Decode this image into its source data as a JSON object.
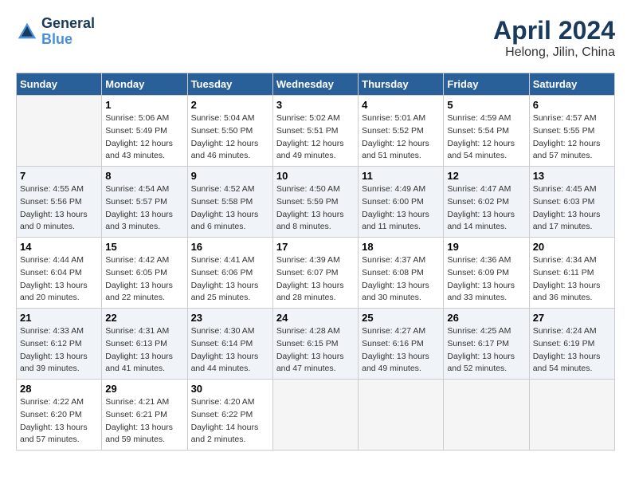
{
  "header": {
    "logo_line1": "General",
    "logo_line2": "Blue",
    "month_title": "April 2024",
    "location": "Helong, Jilin, China"
  },
  "weekdays": [
    "Sunday",
    "Monday",
    "Tuesday",
    "Wednesday",
    "Thursday",
    "Friday",
    "Saturday"
  ],
  "weeks": [
    [
      {
        "day": "",
        "empty": true
      },
      {
        "day": "1",
        "sunrise": "Sunrise: 5:06 AM",
        "sunset": "Sunset: 5:49 PM",
        "daylight": "Daylight: 12 hours and 43 minutes."
      },
      {
        "day": "2",
        "sunrise": "Sunrise: 5:04 AM",
        "sunset": "Sunset: 5:50 PM",
        "daylight": "Daylight: 12 hours and 46 minutes."
      },
      {
        "day": "3",
        "sunrise": "Sunrise: 5:02 AM",
        "sunset": "Sunset: 5:51 PM",
        "daylight": "Daylight: 12 hours and 49 minutes."
      },
      {
        "day": "4",
        "sunrise": "Sunrise: 5:01 AM",
        "sunset": "Sunset: 5:52 PM",
        "daylight": "Daylight: 12 hours and 51 minutes."
      },
      {
        "day": "5",
        "sunrise": "Sunrise: 4:59 AM",
        "sunset": "Sunset: 5:54 PM",
        "daylight": "Daylight: 12 hours and 54 minutes."
      },
      {
        "day": "6",
        "sunrise": "Sunrise: 4:57 AM",
        "sunset": "Sunset: 5:55 PM",
        "daylight": "Daylight: 12 hours and 57 minutes."
      }
    ],
    [
      {
        "day": "7",
        "sunrise": "Sunrise: 4:55 AM",
        "sunset": "Sunset: 5:56 PM",
        "daylight": "Daylight: 13 hours and 0 minutes."
      },
      {
        "day": "8",
        "sunrise": "Sunrise: 4:54 AM",
        "sunset": "Sunset: 5:57 PM",
        "daylight": "Daylight: 13 hours and 3 minutes."
      },
      {
        "day": "9",
        "sunrise": "Sunrise: 4:52 AM",
        "sunset": "Sunset: 5:58 PM",
        "daylight": "Daylight: 13 hours and 6 minutes."
      },
      {
        "day": "10",
        "sunrise": "Sunrise: 4:50 AM",
        "sunset": "Sunset: 5:59 PM",
        "daylight": "Daylight: 13 hours and 8 minutes."
      },
      {
        "day": "11",
        "sunrise": "Sunrise: 4:49 AM",
        "sunset": "Sunset: 6:00 PM",
        "daylight": "Daylight: 13 hours and 11 minutes."
      },
      {
        "day": "12",
        "sunrise": "Sunrise: 4:47 AM",
        "sunset": "Sunset: 6:02 PM",
        "daylight": "Daylight: 13 hours and 14 minutes."
      },
      {
        "day": "13",
        "sunrise": "Sunrise: 4:45 AM",
        "sunset": "Sunset: 6:03 PM",
        "daylight": "Daylight: 13 hours and 17 minutes."
      }
    ],
    [
      {
        "day": "14",
        "sunrise": "Sunrise: 4:44 AM",
        "sunset": "Sunset: 6:04 PM",
        "daylight": "Daylight: 13 hours and 20 minutes."
      },
      {
        "day": "15",
        "sunrise": "Sunrise: 4:42 AM",
        "sunset": "Sunset: 6:05 PM",
        "daylight": "Daylight: 13 hours and 22 minutes."
      },
      {
        "day": "16",
        "sunrise": "Sunrise: 4:41 AM",
        "sunset": "Sunset: 6:06 PM",
        "daylight": "Daylight: 13 hours and 25 minutes."
      },
      {
        "day": "17",
        "sunrise": "Sunrise: 4:39 AM",
        "sunset": "Sunset: 6:07 PM",
        "daylight": "Daylight: 13 hours and 28 minutes."
      },
      {
        "day": "18",
        "sunrise": "Sunrise: 4:37 AM",
        "sunset": "Sunset: 6:08 PM",
        "daylight": "Daylight: 13 hours and 30 minutes."
      },
      {
        "day": "19",
        "sunrise": "Sunrise: 4:36 AM",
        "sunset": "Sunset: 6:09 PM",
        "daylight": "Daylight: 13 hours and 33 minutes."
      },
      {
        "day": "20",
        "sunrise": "Sunrise: 4:34 AM",
        "sunset": "Sunset: 6:11 PM",
        "daylight": "Daylight: 13 hours and 36 minutes."
      }
    ],
    [
      {
        "day": "21",
        "sunrise": "Sunrise: 4:33 AM",
        "sunset": "Sunset: 6:12 PM",
        "daylight": "Daylight: 13 hours and 39 minutes."
      },
      {
        "day": "22",
        "sunrise": "Sunrise: 4:31 AM",
        "sunset": "Sunset: 6:13 PM",
        "daylight": "Daylight: 13 hours and 41 minutes."
      },
      {
        "day": "23",
        "sunrise": "Sunrise: 4:30 AM",
        "sunset": "Sunset: 6:14 PM",
        "daylight": "Daylight: 13 hours and 44 minutes."
      },
      {
        "day": "24",
        "sunrise": "Sunrise: 4:28 AM",
        "sunset": "Sunset: 6:15 PM",
        "daylight": "Daylight: 13 hours and 47 minutes."
      },
      {
        "day": "25",
        "sunrise": "Sunrise: 4:27 AM",
        "sunset": "Sunset: 6:16 PM",
        "daylight": "Daylight: 13 hours and 49 minutes."
      },
      {
        "day": "26",
        "sunrise": "Sunrise: 4:25 AM",
        "sunset": "Sunset: 6:17 PM",
        "daylight": "Daylight: 13 hours and 52 minutes."
      },
      {
        "day": "27",
        "sunrise": "Sunrise: 4:24 AM",
        "sunset": "Sunset: 6:19 PM",
        "daylight": "Daylight: 13 hours and 54 minutes."
      }
    ],
    [
      {
        "day": "28",
        "sunrise": "Sunrise: 4:22 AM",
        "sunset": "Sunset: 6:20 PM",
        "daylight": "Daylight: 13 hours and 57 minutes."
      },
      {
        "day": "29",
        "sunrise": "Sunrise: 4:21 AM",
        "sunset": "Sunset: 6:21 PM",
        "daylight": "Daylight: 13 hours and 59 minutes."
      },
      {
        "day": "30",
        "sunrise": "Sunrise: 4:20 AM",
        "sunset": "Sunset: 6:22 PM",
        "daylight": "Daylight: 14 hours and 2 minutes."
      },
      {
        "day": "",
        "empty": true
      },
      {
        "day": "",
        "empty": true
      },
      {
        "day": "",
        "empty": true
      },
      {
        "day": "",
        "empty": true
      }
    ]
  ]
}
